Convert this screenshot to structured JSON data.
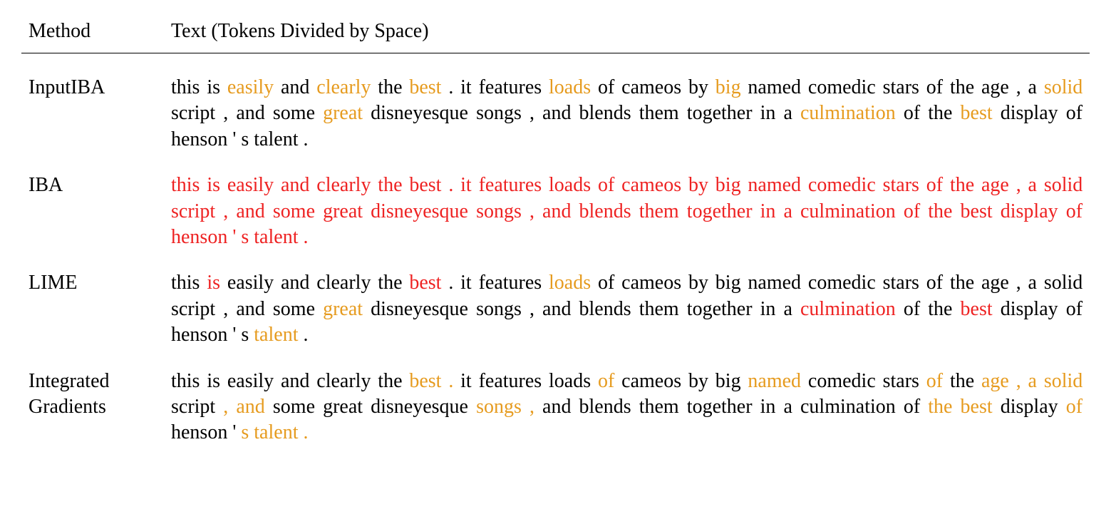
{
  "headers": {
    "method": "Method",
    "text": "Text (Tokens Divided by Space)"
  },
  "rows": [
    {
      "method": "InputIBA",
      "tokens": [
        {
          "t": "this",
          "c": "black"
        },
        {
          "t": "is",
          "c": "black"
        },
        {
          "t": "easily",
          "c": "orange"
        },
        {
          "t": "and",
          "c": "black"
        },
        {
          "t": "clearly",
          "c": "orange"
        },
        {
          "t": "the",
          "c": "black"
        },
        {
          "t": "best",
          "c": "orange"
        },
        {
          "t": ".",
          "c": "black"
        },
        {
          "t": "it",
          "c": "black"
        },
        {
          "t": "features",
          "c": "black"
        },
        {
          "t": "loads",
          "c": "orange"
        },
        {
          "t": "of",
          "c": "black"
        },
        {
          "t": "cameos",
          "c": "black"
        },
        {
          "t": "by",
          "c": "black"
        },
        {
          "t": "big",
          "c": "orange"
        },
        {
          "t": "named",
          "c": "black"
        },
        {
          "t": "comedic",
          "c": "black"
        },
        {
          "t": "stars",
          "c": "black"
        },
        {
          "t": "of",
          "c": "black"
        },
        {
          "t": "the",
          "c": "black"
        },
        {
          "t": "age",
          "c": "black"
        },
        {
          "t": ",",
          "c": "black"
        },
        {
          "t": "a",
          "c": "black"
        },
        {
          "t": "solid",
          "c": "orange"
        },
        {
          "t": "script",
          "c": "black"
        },
        {
          "t": ",",
          "c": "black"
        },
        {
          "t": "and",
          "c": "black"
        },
        {
          "t": "some",
          "c": "black"
        },
        {
          "t": "great",
          "c": "orange"
        },
        {
          "t": "disneyesque",
          "c": "black"
        },
        {
          "t": "songs",
          "c": "black"
        },
        {
          "t": ",",
          "c": "black"
        },
        {
          "t": "and",
          "c": "black"
        },
        {
          "t": "blends",
          "c": "black"
        },
        {
          "t": "them",
          "c": "black"
        },
        {
          "t": "together",
          "c": "black"
        },
        {
          "t": "in",
          "c": "black"
        },
        {
          "t": "a",
          "c": "black"
        },
        {
          "t": "culmination",
          "c": "orange"
        },
        {
          "t": "of",
          "c": "black"
        },
        {
          "t": "the",
          "c": "black"
        },
        {
          "t": "best",
          "c": "orange"
        },
        {
          "t": "display",
          "c": "black"
        },
        {
          "t": "of",
          "c": "black"
        },
        {
          "t": "henson",
          "c": "black"
        },
        {
          "t": "'",
          "c": "black"
        },
        {
          "t": "s",
          "c": "black"
        },
        {
          "t": "talent",
          "c": "black"
        },
        {
          "t": ".",
          "c": "black"
        }
      ]
    },
    {
      "method": "IBA",
      "tokens": [
        {
          "t": "this",
          "c": "red"
        },
        {
          "t": "is",
          "c": "red"
        },
        {
          "t": "easily",
          "c": "red"
        },
        {
          "t": "and",
          "c": "red"
        },
        {
          "t": "clearly",
          "c": "red"
        },
        {
          "t": "the",
          "c": "red"
        },
        {
          "t": "best",
          "c": "red"
        },
        {
          "t": ".",
          "c": "red"
        },
        {
          "t": "it",
          "c": "red"
        },
        {
          "t": "features",
          "c": "red"
        },
        {
          "t": "loads",
          "c": "red"
        },
        {
          "t": "of",
          "c": "red"
        },
        {
          "t": "cameos",
          "c": "red"
        },
        {
          "t": "by",
          "c": "red"
        },
        {
          "t": "big",
          "c": "red"
        },
        {
          "t": "named",
          "c": "red"
        },
        {
          "t": "comedic",
          "c": "red"
        },
        {
          "t": "stars",
          "c": "red"
        },
        {
          "t": "of",
          "c": "red"
        },
        {
          "t": "the",
          "c": "red"
        },
        {
          "t": "age",
          "c": "red"
        },
        {
          "t": ",",
          "c": "red"
        },
        {
          "t": "a",
          "c": "red"
        },
        {
          "t": "solid",
          "c": "red"
        },
        {
          "t": "script",
          "c": "red"
        },
        {
          "t": ",",
          "c": "red"
        },
        {
          "t": "and",
          "c": "red"
        },
        {
          "t": "some",
          "c": "red"
        },
        {
          "t": "great",
          "c": "red"
        },
        {
          "t": "disneyesque",
          "c": "red"
        },
        {
          "t": "songs",
          "c": "red"
        },
        {
          "t": ",",
          "c": "red"
        },
        {
          "t": "and",
          "c": "red"
        },
        {
          "t": "blends",
          "c": "red"
        },
        {
          "t": "them",
          "c": "red"
        },
        {
          "t": "together",
          "c": "red"
        },
        {
          "t": "in",
          "c": "red"
        },
        {
          "t": "a",
          "c": "red"
        },
        {
          "t": "culmination",
          "c": "red"
        },
        {
          "t": "of",
          "c": "red"
        },
        {
          "t": "the",
          "c": "red"
        },
        {
          "t": "best",
          "c": "red"
        },
        {
          "t": "display",
          "c": "red"
        },
        {
          "t": "of",
          "c": "red"
        },
        {
          "t": "henson",
          "c": "red"
        },
        {
          "t": "'",
          "c": "red"
        },
        {
          "t": "s",
          "c": "red"
        },
        {
          "t": "talent",
          "c": "red"
        },
        {
          "t": ".",
          "c": "red"
        }
      ]
    },
    {
      "method": "LIME",
      "tokens": [
        {
          "t": "this",
          "c": "black"
        },
        {
          "t": "is",
          "c": "red"
        },
        {
          "t": "easily",
          "c": "black"
        },
        {
          "t": "and",
          "c": "black"
        },
        {
          "t": "clearly",
          "c": "black"
        },
        {
          "t": "the",
          "c": "black"
        },
        {
          "t": "best",
          "c": "red"
        },
        {
          "t": ".",
          "c": "black"
        },
        {
          "t": "it",
          "c": "black"
        },
        {
          "t": "features",
          "c": "black"
        },
        {
          "t": "loads",
          "c": "orange"
        },
        {
          "t": "of",
          "c": "black"
        },
        {
          "t": "cameos",
          "c": "black"
        },
        {
          "t": "by",
          "c": "black"
        },
        {
          "t": "big",
          "c": "black"
        },
        {
          "t": "named",
          "c": "black"
        },
        {
          "t": "comedic",
          "c": "black"
        },
        {
          "t": "stars",
          "c": "black"
        },
        {
          "t": "of",
          "c": "black"
        },
        {
          "t": "the",
          "c": "black"
        },
        {
          "t": "age",
          "c": "black"
        },
        {
          "t": ",",
          "c": "black"
        },
        {
          "t": "a",
          "c": "black"
        },
        {
          "t": "solid",
          "c": "black"
        },
        {
          "t": "script",
          "c": "black"
        },
        {
          "t": ",",
          "c": "black"
        },
        {
          "t": "and",
          "c": "black"
        },
        {
          "t": "some",
          "c": "black"
        },
        {
          "t": "great",
          "c": "orange"
        },
        {
          "t": "disneyesque",
          "c": "black"
        },
        {
          "t": "songs",
          "c": "black"
        },
        {
          "t": ",",
          "c": "black"
        },
        {
          "t": "and",
          "c": "black"
        },
        {
          "t": "blends",
          "c": "black"
        },
        {
          "t": "them",
          "c": "black"
        },
        {
          "t": "together",
          "c": "black"
        },
        {
          "t": "in",
          "c": "black"
        },
        {
          "t": "a",
          "c": "black"
        },
        {
          "t": "culmination",
          "c": "red"
        },
        {
          "t": "of",
          "c": "black"
        },
        {
          "t": "the",
          "c": "black"
        },
        {
          "t": "best",
          "c": "red"
        },
        {
          "t": "display",
          "c": "black"
        },
        {
          "t": "of",
          "c": "black"
        },
        {
          "t": "henson",
          "c": "black"
        },
        {
          "t": "'",
          "c": "black"
        },
        {
          "t": "s",
          "c": "black"
        },
        {
          "t": "talent",
          "c": "orange"
        },
        {
          "t": ".",
          "c": "black"
        }
      ]
    },
    {
      "method": "Integrated Gradients",
      "tokens": [
        {
          "t": "this",
          "c": "black"
        },
        {
          "t": "is",
          "c": "black"
        },
        {
          "t": "easily",
          "c": "black"
        },
        {
          "t": "and",
          "c": "black"
        },
        {
          "t": "clearly",
          "c": "black"
        },
        {
          "t": "the",
          "c": "black"
        },
        {
          "t": "best",
          "c": "orange"
        },
        {
          "t": ".",
          "c": "orange"
        },
        {
          "t": "it",
          "c": "black"
        },
        {
          "t": "features",
          "c": "black"
        },
        {
          "t": "loads",
          "c": "black"
        },
        {
          "t": "of",
          "c": "orange"
        },
        {
          "t": "cameos",
          "c": "black"
        },
        {
          "t": "by",
          "c": "black"
        },
        {
          "t": "big",
          "c": "black"
        },
        {
          "t": "named",
          "c": "orange"
        },
        {
          "t": "comedic",
          "c": "black"
        },
        {
          "t": "stars",
          "c": "black"
        },
        {
          "t": "of",
          "c": "orange"
        },
        {
          "t": "the",
          "c": "black"
        },
        {
          "t": "age",
          "c": "orange"
        },
        {
          "t": ",",
          "c": "orange"
        },
        {
          "t": "a",
          "c": "orange"
        },
        {
          "t": "solid",
          "c": "orange"
        },
        {
          "t": "script",
          "c": "black"
        },
        {
          "t": ",",
          "c": "orange"
        },
        {
          "t": "and",
          "c": "orange"
        },
        {
          "t": "some",
          "c": "black"
        },
        {
          "t": "great",
          "c": "black"
        },
        {
          "t": "disneyesque",
          "c": "black"
        },
        {
          "t": "songs",
          "c": "orange"
        },
        {
          "t": ",",
          "c": "orange"
        },
        {
          "t": "and",
          "c": "black"
        },
        {
          "t": "blends",
          "c": "black"
        },
        {
          "t": "them",
          "c": "black"
        },
        {
          "t": "together",
          "c": "black"
        },
        {
          "t": "in",
          "c": "black"
        },
        {
          "t": "a",
          "c": "black"
        },
        {
          "t": "culmination",
          "c": "black"
        },
        {
          "t": "of",
          "c": "black"
        },
        {
          "t": "the",
          "c": "orange"
        },
        {
          "t": "best",
          "c": "orange"
        },
        {
          "t": "display",
          "c": "black"
        },
        {
          "t": "of",
          "c": "orange"
        },
        {
          "t": "henson",
          "c": "black"
        },
        {
          "t": "'",
          "c": "black"
        },
        {
          "t": "s",
          "c": "orange"
        },
        {
          "t": "talent",
          "c": "orange"
        },
        {
          "t": ".",
          "c": "orange"
        }
      ]
    }
  ]
}
